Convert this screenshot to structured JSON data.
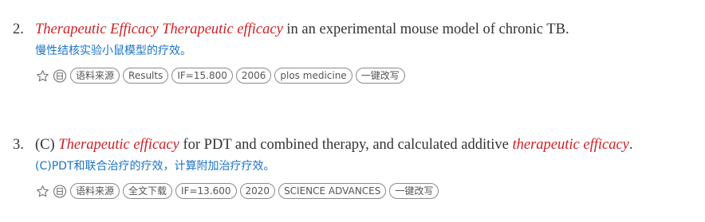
{
  "results": [
    {
      "number": "2.",
      "highlight_1": "Therapeutic Efficacy Therapeutic efficacy",
      "text_1": " in an experimental mouse model of chronic TB.",
      "translation": "慢性结核实验小鼠模型的疗效。",
      "tags": {
        "source": "语料来源",
        "section": "Results",
        "impact_factor": "IF=15.800",
        "year": "2006",
        "journal": "plos medicine",
        "rewrite": "一键改写"
      },
      "icons": {
        "favorite": "star-outline-icon",
        "reply": "reply-circle-icon"
      }
    },
    {
      "number": "3.",
      "prefix": "(C) ",
      "highlight_1": "Therapeutic efficacy",
      "text_1": " for PDT and combined therapy, and calculated additive ",
      "highlight_2": "therapeutic efficacy",
      "text_2": ".",
      "translation": "(C)PDT和联合治疗的疗效，计算附加治疗疗效。",
      "tags": {
        "source": "语料来源",
        "section": "全文下载",
        "impact_factor": "IF=13.600",
        "year": "2020",
        "journal": "SCIENCE ADVANCES",
        "rewrite": "一键改写"
      },
      "icons": {
        "favorite": "star-outline-icon",
        "reply": "reply-circle-icon"
      }
    }
  ],
  "colors": {
    "highlight": "#d01f24",
    "translation": "#1a73c9",
    "body_text": "#333333",
    "tag_border": "#8a8a8a"
  }
}
